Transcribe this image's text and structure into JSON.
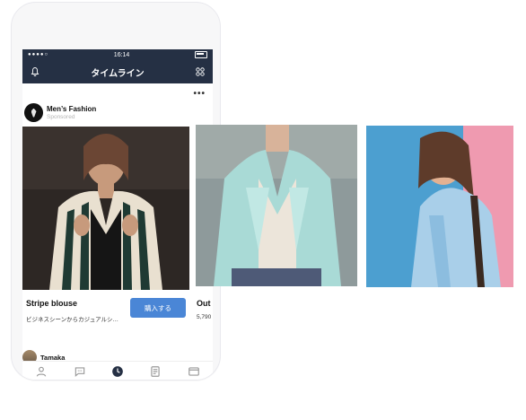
{
  "status_bar": {
    "time": "16:14"
  },
  "nav": {
    "title": "タイムライン",
    "left_icon": "bell-icon",
    "right_icon": "apps-grid-icon"
  },
  "post": {
    "account_name": "Men’s Fashion",
    "sponsored": "Sponsored",
    "more": "•••"
  },
  "carousel": {
    "cards": [
      {
        "title": "Stripe blouse",
        "description": "ビジネスシーンからカジュアルシ…",
        "cta": "購入する",
        "image": "woman in striped blouse"
      },
      {
        "title": "Out",
        "price": "5,790",
        "image": "woman in mint drape jacket"
      },
      {
        "image": "woman in denim jacket"
      }
    ]
  },
  "next_post": {
    "name": "Tamaka"
  },
  "tabs": [
    {
      "name": "friends",
      "icon": "person-icon"
    },
    {
      "name": "chats",
      "icon": "chat-icon"
    },
    {
      "name": "timeline",
      "icon": "clock-icon",
      "active": true
    },
    {
      "name": "news",
      "icon": "news-icon"
    },
    {
      "name": "wallet",
      "icon": "wallet-icon"
    }
  ],
  "colors": {
    "navbar": "#253044",
    "button": "#4a86d6"
  }
}
